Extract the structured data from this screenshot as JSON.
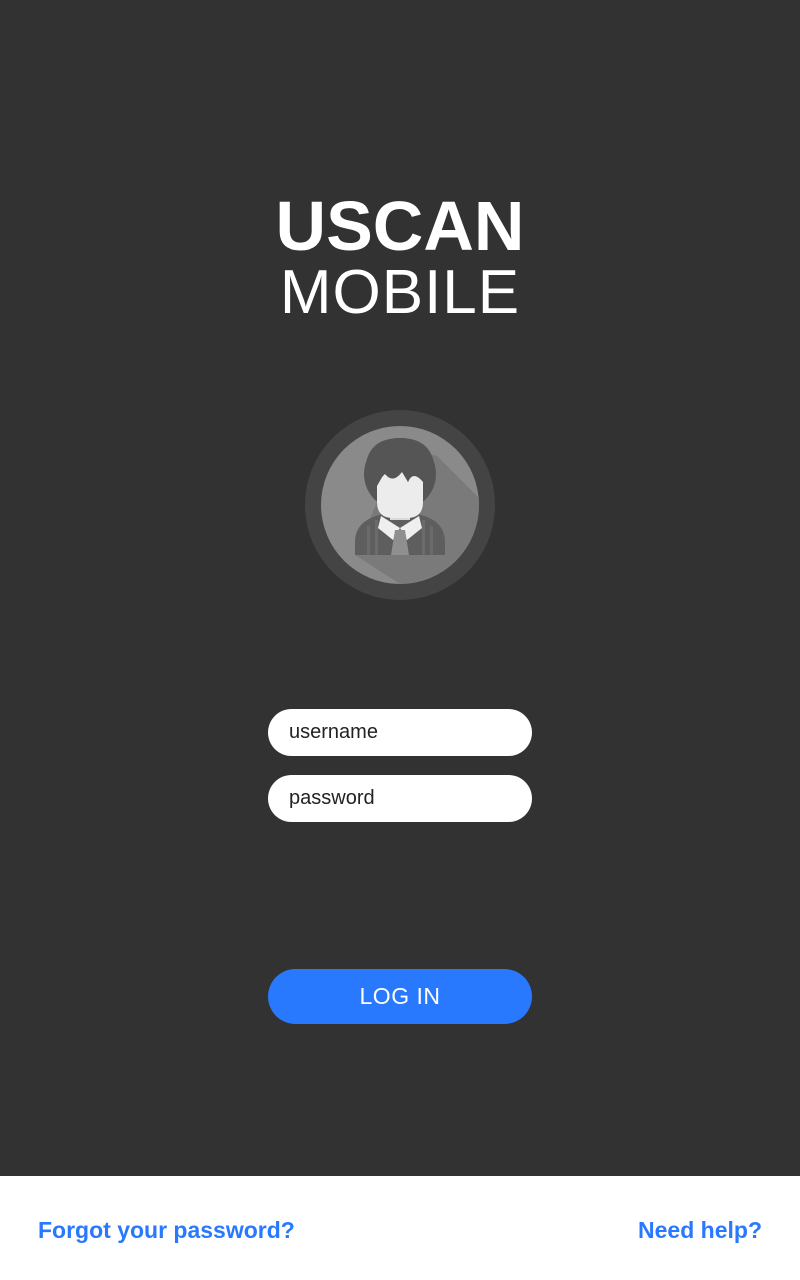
{
  "logo": {
    "line1": "USCAN",
    "line2": "MOBILE"
  },
  "avatar": {
    "icon": "user-avatar-icon"
  },
  "form": {
    "username_placeholder": "username",
    "password_placeholder": "password",
    "login_label": "LOG IN"
  },
  "footer": {
    "forgot_label": "Forgot your password?",
    "help_label": "Need help?"
  },
  "colors": {
    "background": "#323232",
    "accent": "#2979ff",
    "footer_background": "#ffffff"
  }
}
